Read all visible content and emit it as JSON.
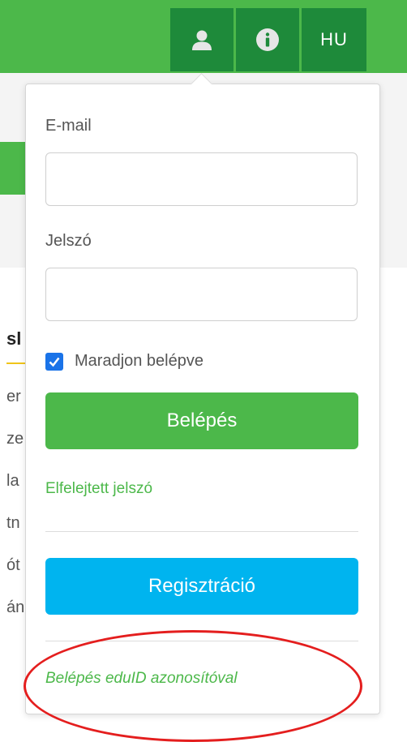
{
  "header": {
    "language_label": "HU",
    "brand_color": "#4cb84a",
    "button_color": "#1e8a3a"
  },
  "icons": {
    "user": "user-icon",
    "info": "info-icon",
    "check": "check-icon"
  },
  "background": {
    "heading_fragment": "sl",
    "line_fragments": [
      "er",
      "ze",
      "la",
      "tn",
      "ót",
      "án"
    ]
  },
  "login": {
    "email_label": "E-mail",
    "email_value": "",
    "password_label": "Jelszó",
    "password_value": "",
    "remember_label": "Maradjon belépve",
    "remember_checked": true,
    "login_button": "Belépés",
    "forgot_link": "Elfelejtett jelszó",
    "register_button": "Regisztráció",
    "eduid_link": "Belépés eduID azonosítóval"
  },
  "annotation_color": "#e41e1e"
}
